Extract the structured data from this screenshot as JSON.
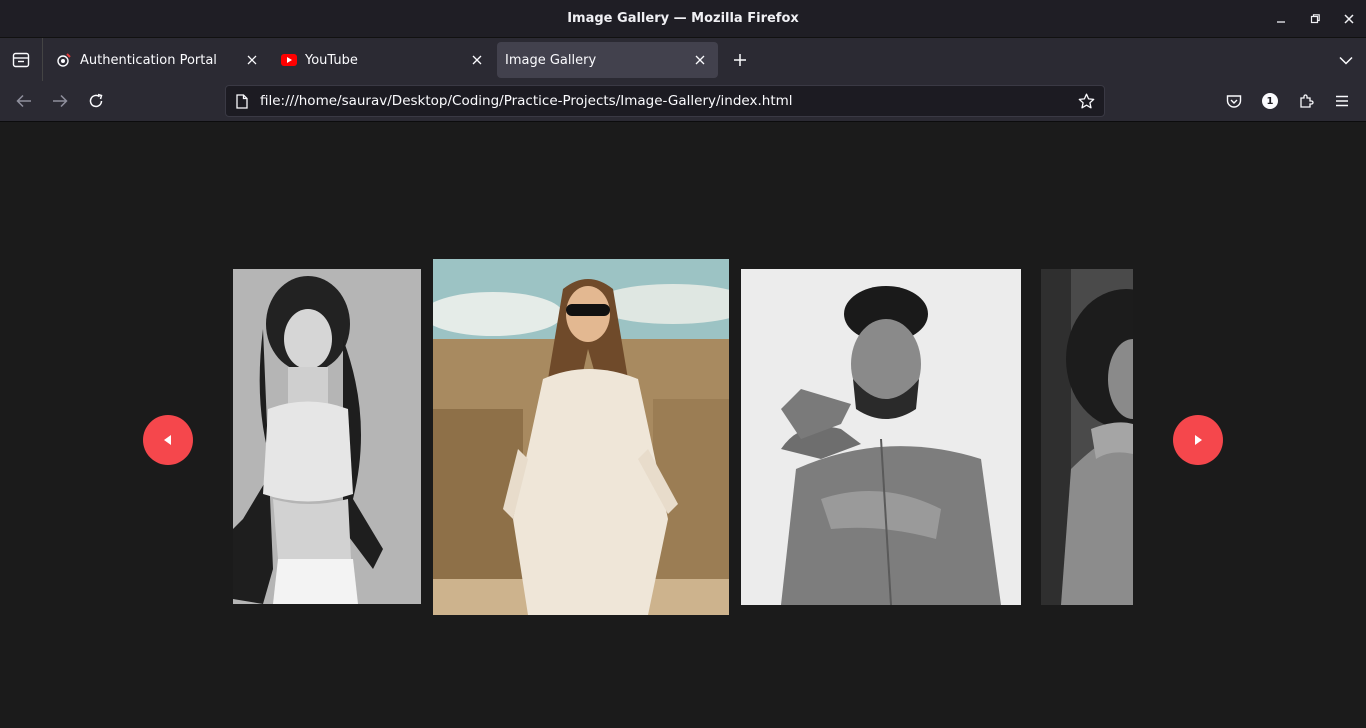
{
  "window": {
    "title": "Image Gallery — Mozilla Firefox"
  },
  "tabs": [
    {
      "label": "Authentication Portal",
      "icon": "auth-portal-favicon",
      "active": false
    },
    {
      "label": "YouTube",
      "icon": "youtube-favicon",
      "active": false
    },
    {
      "label": "Image Gallery",
      "icon": "none",
      "active": true
    }
  ],
  "navbar": {
    "url": "file:///home/saurav/Desktop/Coding/Practice-Projects/Image-Gallery/index.html",
    "extensions_badge": "1"
  },
  "gallery": {
    "images": [
      {
        "description": "grayscale-curly-haired-woman"
      },
      {
        "description": "woman-in-sunglasses-white-dress"
      },
      {
        "description": "grayscale-smiling-bearded-man"
      },
      {
        "description": "grayscale-partial-portrait"
      }
    ],
    "accent_color": "#f5474c"
  }
}
